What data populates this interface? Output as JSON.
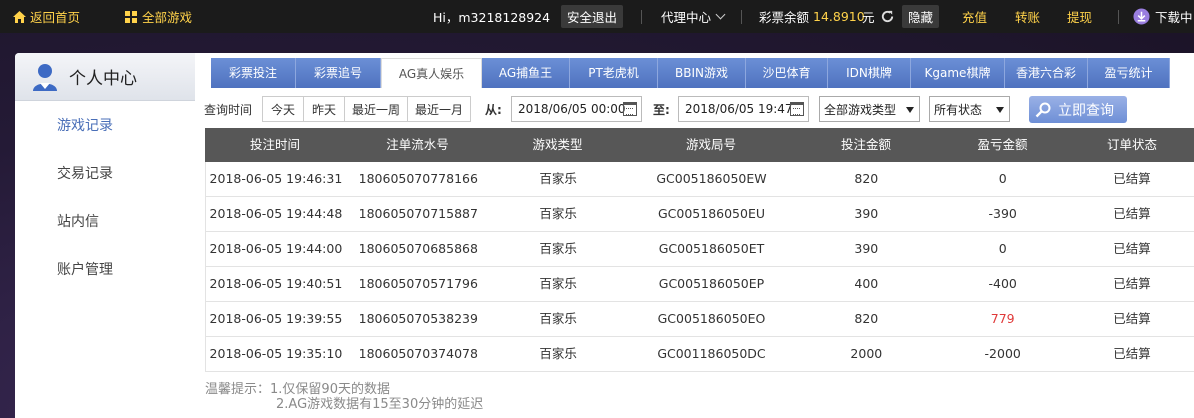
{
  "topbar": {
    "home": "返回首页",
    "all_games": "全部游戏",
    "greeting": "Hi，m3218128924",
    "logout": "安全退出",
    "agent": "代理中心",
    "balance_label": "彩票余额",
    "balance_value": "14.8910",
    "balance_unit": "元",
    "hide": "隐藏",
    "recharge": "充值",
    "transfer": "转账",
    "withdraw": "提现",
    "download": "下载中"
  },
  "sidebar": {
    "title": "个人中心",
    "items": [
      {
        "label": "游戏记录",
        "active": true
      },
      {
        "label": "交易记录",
        "active": false
      },
      {
        "label": "站内信",
        "active": false
      },
      {
        "label": "账户管理",
        "active": false
      }
    ]
  },
  "tabs": [
    {
      "label": "彩票投注",
      "active": false
    },
    {
      "label": "彩票追号",
      "active": false
    },
    {
      "label": "AG真人娱乐",
      "active": true
    },
    {
      "label": "AG捕鱼王",
      "active": false
    },
    {
      "label": "PT老虎机",
      "active": false
    },
    {
      "label": "BBIN游戏",
      "active": false
    },
    {
      "label": "沙巴体育",
      "active": false
    },
    {
      "label": "IDN棋牌",
      "active": false
    },
    {
      "label": "Kgame棋牌",
      "active": false
    },
    {
      "label": "香港六合彩",
      "active": false
    },
    {
      "label": "盈亏统计",
      "active": false
    }
  ],
  "filter": {
    "label": "查询时间",
    "quick": [
      "今天",
      "昨天",
      "最近一周",
      "最近一月"
    ],
    "from_label": "从:",
    "from_value": "2018/06/05 00:00",
    "to_label": "至:",
    "to_value": "2018/06/05 19:47",
    "game_type": "全部游戏类型",
    "status": "所有状态",
    "query_button": "立即查询"
  },
  "table": {
    "headers": [
      "投注时间",
      "注单流水号",
      "游戏类型",
      "游戏局号",
      "投注金额",
      "盈亏金额",
      "订单状态"
    ],
    "rows": [
      [
        "2018-06-05 19:46:31",
        "180605070778166",
        "百家乐",
        "GC005186050EW",
        "820",
        "0",
        "已结算"
      ],
      [
        "2018-06-05 19:44:48",
        "180605070715887",
        "百家乐",
        "GC005186050EU",
        "390",
        "-390",
        "已结算"
      ],
      [
        "2018-06-05 19:44:00",
        "180605070685868",
        "百家乐",
        "GC005186050ET",
        "390",
        "0",
        "已结算"
      ],
      [
        "2018-06-05 19:40:51",
        "180605070571796",
        "百家乐",
        "GC005186050EP",
        "400",
        "-400",
        "已结算"
      ],
      [
        "2018-06-05 19:39:55",
        "180605070538239",
        "百家乐",
        "GC005186050EO",
        "820",
        "779",
        "已结算"
      ],
      [
        "2018-06-05 19:35:10",
        "180605070374078",
        "百家乐",
        "GC001186050DC",
        "2000",
        "-2000",
        "已结算"
      ]
    ],
    "positive_color": "#e03a3a"
  },
  "tips": {
    "prefix": "温馨提示：",
    "line1": "1.仅保留90天的数据",
    "line2": "2.AG游戏数据有15至30分钟的延迟"
  },
  "colors": {
    "accent_yellow": "#ffd24a",
    "tab_blue": "#5a7dc8",
    "header_gray": "#575757"
  }
}
